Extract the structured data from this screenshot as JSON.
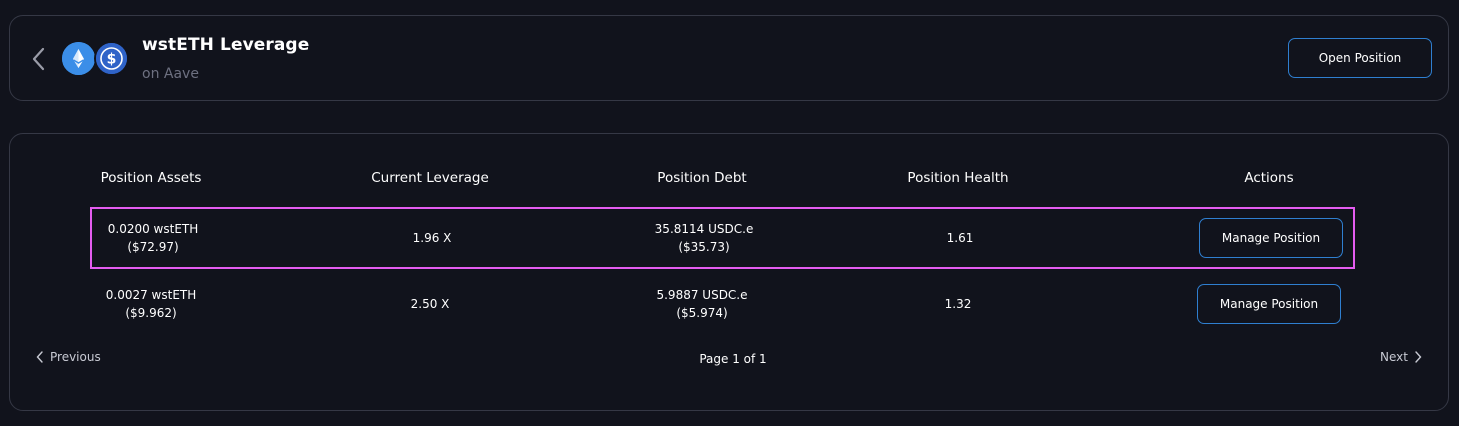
{
  "header": {
    "title": "wstETH Leverage",
    "subtitle": "on Aave",
    "open_position_label": "Open Position",
    "tokens": [
      "wsteth-icon",
      "usdc-icon"
    ]
  },
  "table": {
    "columns": [
      "Position Assets",
      "Current Leverage",
      "Position Debt",
      "Position Health",
      "Actions"
    ],
    "rows": [
      {
        "assets_amount": "0.0200 wstETH",
        "assets_usd": "($72.97)",
        "leverage": "1.96 X",
        "debt_amount": "35.8114 USDC.e",
        "debt_usd": "($35.73)",
        "health": "1.61",
        "action_label": "Manage Position",
        "highlighted": true
      },
      {
        "assets_amount": "0.0027 wstETH",
        "assets_usd": "($9.962)",
        "leverage": "2.50 X",
        "debt_amount": "5.9887 USDC.e",
        "debt_usd": "($5.974)",
        "health": "1.32",
        "action_label": "Manage Position",
        "highlighted": false
      }
    ]
  },
  "pagination": {
    "previous_label": "Previous",
    "next_label": "Next",
    "page_info": "Page 1 of 1"
  },
  "colors": {
    "background": "#11131c",
    "border": "#353845",
    "accent_blue": "#2f7fd0",
    "highlight": "#e45cf0",
    "muted_text": "#6d7080"
  }
}
